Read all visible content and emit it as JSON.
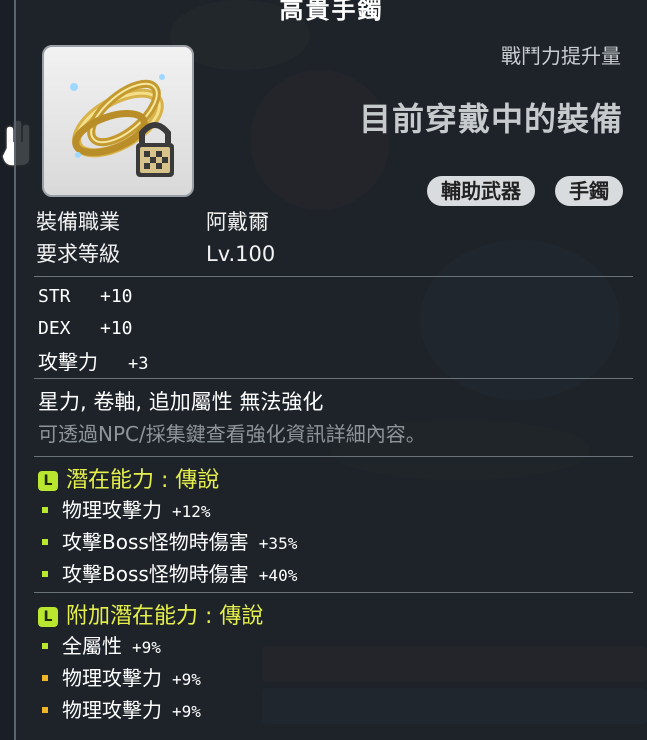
{
  "item": {
    "name": "高貴手鐲",
    "cp_label": "戰鬥力提升量",
    "equip_status": "目前穿戴中的裝備",
    "tags": [
      "輔助武器",
      "手鐲"
    ]
  },
  "requirements": {
    "job_label": "裝備職業",
    "job_value": "阿戴爾",
    "level_label": "要求等級",
    "level_value": "Lv.100"
  },
  "stats": [
    {
      "name": "STR",
      "value": "+10"
    },
    {
      "name": "DEX",
      "value": "+10"
    },
    {
      "name": "攻擊力",
      "value": "+3"
    }
  ],
  "no_enhance_text": "星力, 卷軸, 追加屬性 無法強化",
  "hint_text": "可透過NPC/採集鍵查看強化資訊詳細內容。",
  "potential": {
    "badge": "L",
    "header": "潛在能力 : 傳說",
    "lines": [
      {
        "text": "物理攻擊力",
        "value": "+12%"
      },
      {
        "text": "攻擊Boss怪物時傷害",
        "value": "+35%"
      },
      {
        "text": "攻擊Boss怪物時傷害",
        "value": "+40%"
      }
    ]
  },
  "bonus_potential": {
    "badge": "L",
    "header": "附加潛在能力 : 傳說",
    "lines": [
      {
        "text": "全屬性",
        "value": "+9%"
      },
      {
        "text": "物理攻擊力",
        "value": "+9%"
      },
      {
        "text": "物理攻擊力",
        "value": "+9%"
      }
    ]
  },
  "colors": {
    "legendary": "#b9e62e",
    "bonus_dot": "#f0b429",
    "header_text": "#e6f04a"
  }
}
